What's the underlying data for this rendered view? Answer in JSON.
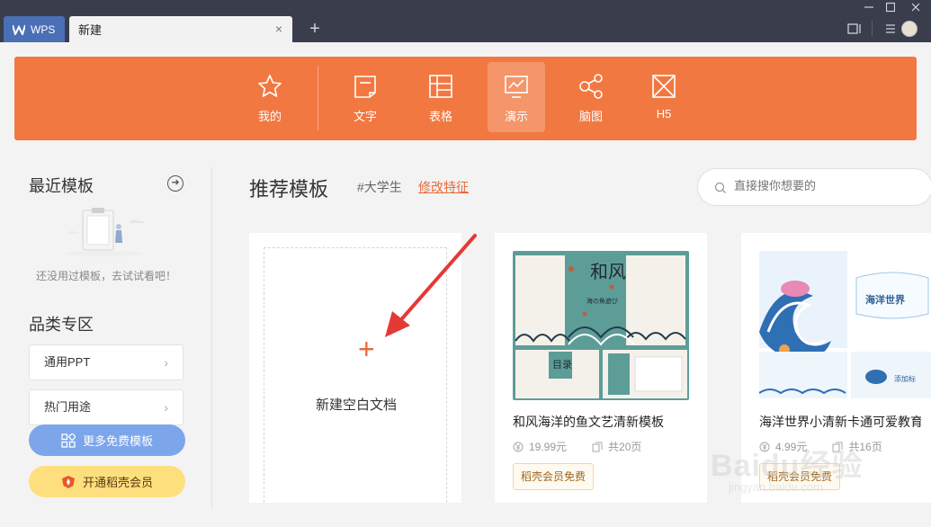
{
  "titlebar": {
    "app_tab": "WPS",
    "doc_tab": "新建",
    "close_symbol": "×",
    "add_symbol": "+"
  },
  "categories": [
    {
      "label": "我的",
      "icon": "star-icon",
      "active": false
    },
    {
      "label": "文字",
      "icon": "document-icon",
      "active": false
    },
    {
      "label": "表格",
      "icon": "table-icon",
      "active": false
    },
    {
      "label": "演示",
      "icon": "presentation-icon",
      "active": true
    },
    {
      "label": "脑图",
      "icon": "mindmap-icon",
      "active": false
    },
    {
      "label": "H5",
      "icon": "h5-icon",
      "active": false
    }
  ],
  "sidebar": {
    "recent_title": "最近模板",
    "empty_text": "还没用过模板，去试试看吧！",
    "category_title": "品类专区",
    "items": [
      {
        "label": "通用PPT"
      },
      {
        "label": "热门用途"
      }
    ],
    "more_button": "更多免费模板",
    "vip_button": "开通稻壳会员"
  },
  "main": {
    "title": "推荐模板",
    "tag": "#大学生",
    "edit_link": "修改特征",
    "search_placeholder": "直接搜你想要的",
    "blank_card": {
      "plus": "+",
      "label": "新建空白文档"
    },
    "templates": [
      {
        "name": "和风海洋的鱼文艺清新模板",
        "price": "19.99元",
        "pages": "共20页",
        "badge": "稻壳会员免费",
        "thumb_title": "和风",
        "thumb_sub": "海の魚遊び",
        "thumb_toc": "目录"
      },
      {
        "name": "海洋世界小清新卡通可爱教育",
        "price": "4.99元",
        "pages": "共16页",
        "badge": "稻壳会员免费",
        "thumb_title": "海洋世界",
        "thumb_sub": "添加标"
      }
    ]
  },
  "watermark": {
    "text": "Baidu经验",
    "url": "jingyan.baidu.com"
  },
  "colors": {
    "titlebar": "#3a3e4c",
    "accent_orange": "#f27841",
    "link_orange": "#e8693a",
    "blue_button": "#7da6ea",
    "yellow_button": "#fddf7e",
    "annotation_red": "#e53935"
  }
}
